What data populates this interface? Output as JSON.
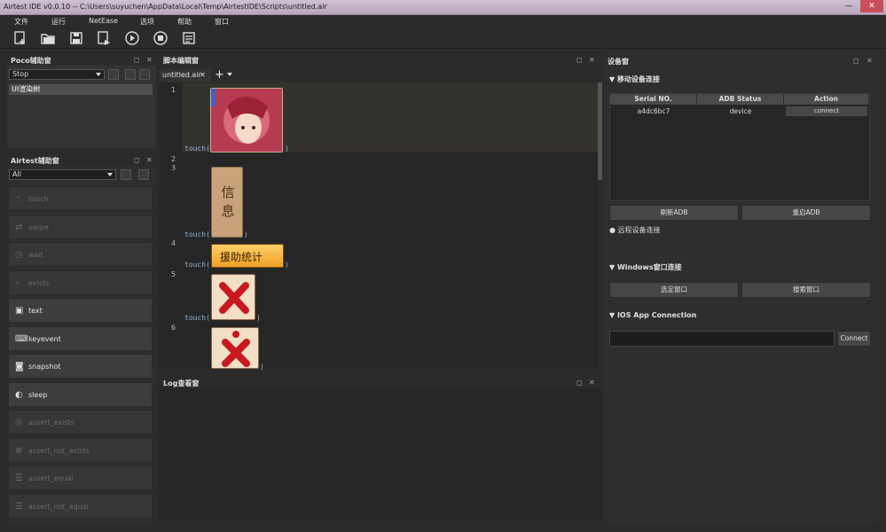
{
  "window": {
    "title": "Airtest IDE v0.0.10 -- C:\\Users\\suyuchen\\AppData\\Local\\Temp\\AirtestIDE\\Scripts\\untitled.air",
    "min": "—",
    "close": "✕"
  },
  "menu": [
    "文件",
    "运行",
    "NetEase",
    "选项",
    "帮助",
    "窗口"
  ],
  "poco": {
    "title": "Poco辅助窗",
    "mode": "Stop",
    "tree_item": "UI渲染树"
  },
  "airtest": {
    "title": "Airtest辅助窗",
    "filter": "All",
    "actions": [
      {
        "label": "touch",
        "icon": "hand-icon",
        "glyph": "☝",
        "enabled": false
      },
      {
        "label": "swipe",
        "icon": "swipe-icon",
        "glyph": "⇄",
        "enabled": false
      },
      {
        "label": "wait",
        "icon": "clock-icon",
        "glyph": "◷",
        "enabled": false
      },
      {
        "label": "exists",
        "icon": "magnifier-icon",
        "glyph": "⌕",
        "enabled": false
      },
      {
        "label": "text",
        "icon": "text-icon",
        "glyph": "▣",
        "enabled": true
      },
      {
        "label": "keyevent",
        "icon": "keyboard-icon",
        "glyph": "⌨",
        "enabled": true
      },
      {
        "label": "snapshot",
        "icon": "camera-icon",
        "glyph": "◙",
        "enabled": true
      },
      {
        "label": "sleep",
        "icon": "moon-icon",
        "glyph": "◐",
        "enabled": true
      },
      {
        "label": "assert_exists",
        "icon": "target-icon",
        "glyph": "◎",
        "enabled": false
      },
      {
        "label": "assert_not_exists",
        "icon": "target-off-icon",
        "glyph": "⊗",
        "enabled": false
      },
      {
        "label": "assert_equal",
        "icon": "equal-icon",
        "glyph": "☰",
        "enabled": false
      },
      {
        "label": "assert_not_equal",
        "icon": "not-equal-icon",
        "glyph": "☰",
        "enabled": false
      }
    ]
  },
  "editor": {
    "title": "脚本编辑窗",
    "tab": "untitled.air",
    "tab_close": "✕",
    "add": "+",
    "line_numbers": [
      "1",
      "2",
      "3",
      "4",
      "5",
      "6"
    ],
    "code_prefix": "touch(",
    "code_suffix": ")",
    "image_2_text": "信息",
    "image_3_text": "援助统计"
  },
  "log": {
    "title": "Log查看窗"
  },
  "device": {
    "title": "设备窗",
    "mobile_section": "▼ 移动设备连接",
    "columns": [
      "Serial NO.",
      "ADB Status",
      "Action"
    ],
    "rows": [
      {
        "serial": "a4dc6bc7",
        "status": "device",
        "action": "connect"
      }
    ],
    "refresh_adb": "刷新ADB",
    "restart_adb": "重启ADB",
    "remote": "● 远程设备连接",
    "windows_section": "▼ Windows窗口连接",
    "select_window": "选定窗口",
    "search_window": "搜索窗口",
    "ios_section": "▼ IOS App Connection",
    "ios_connect": "Connect"
  },
  "colors": {
    "panel_bg": "#333333",
    "editor_bg": "#262626",
    "title_bar": "#c4b3c9",
    "accent_red": "#c8191e"
  }
}
